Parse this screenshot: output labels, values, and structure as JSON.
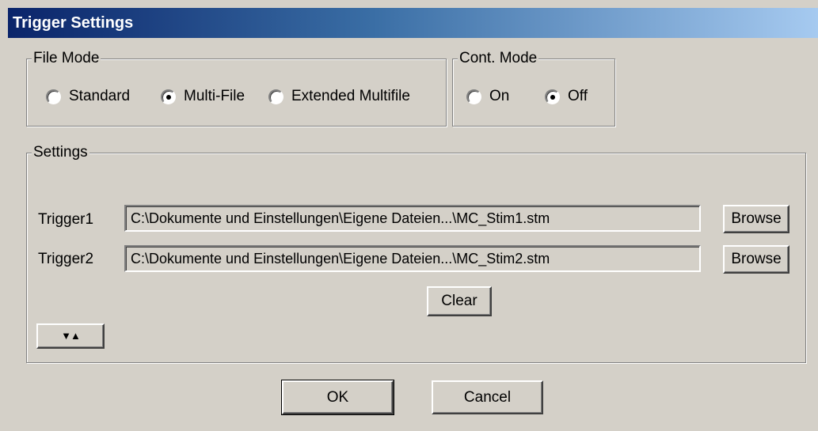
{
  "window": {
    "title": "Trigger Settings"
  },
  "file_mode": {
    "legend": "File Mode",
    "options": [
      {
        "label": "Standard",
        "checked": false
      },
      {
        "label": "Multi-File",
        "checked": true
      },
      {
        "label": "Extended Multifile",
        "checked": false
      }
    ]
  },
  "cont_mode": {
    "legend": "Cont. Mode",
    "options": [
      {
        "label": "On",
        "checked": false
      },
      {
        "label": "Off",
        "checked": true
      }
    ]
  },
  "settings": {
    "legend": "Settings",
    "triggers": [
      {
        "label": "Trigger1",
        "value": "C:\\Dokumente und Einstellungen\\Eigene Dateien...\\MC_Stim1.stm",
        "browse_label": "Browse"
      },
      {
        "label": "Trigger2",
        "value": "C:\\Dokumente und Einstellungen\\Eigene Dateien...\\MC_Stim2.stm",
        "browse_label": "Browse"
      }
    ],
    "clear_label": "Clear",
    "expand_toggle_icon": "down-up-triangles-icon"
  },
  "footer": {
    "ok_label": "OK",
    "cancel_label": "Cancel"
  }
}
